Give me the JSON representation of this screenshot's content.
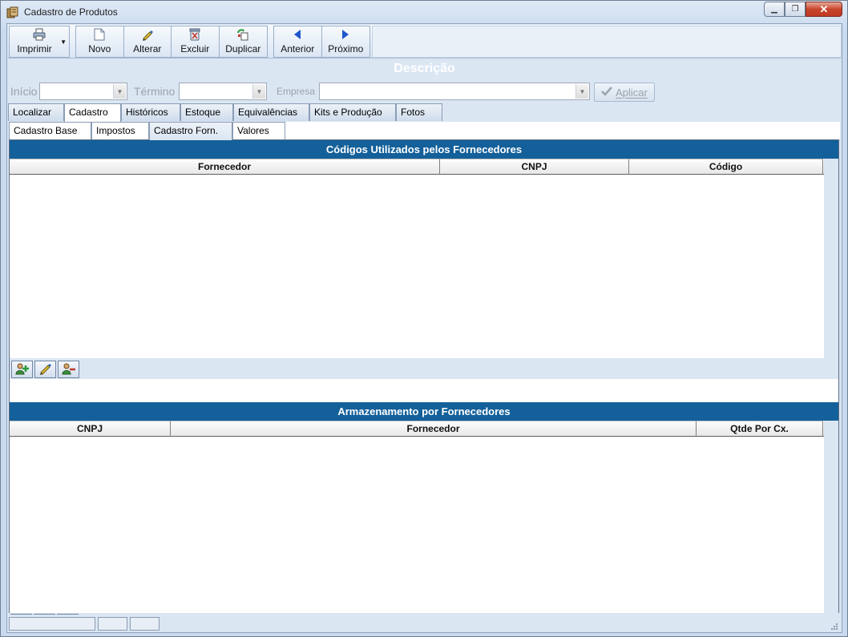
{
  "window": {
    "title": "Cadastro de Produtos"
  },
  "toolbar": {
    "imprimir": "Imprimir",
    "novo": "Novo",
    "alterar": "Alterar",
    "excluir": "Excluir",
    "duplicar": "Duplicar",
    "anterior": "Anterior",
    "proximo": "Próximo"
  },
  "header": {
    "descricao": "Descrição"
  },
  "filters": {
    "inicio_label": "Início",
    "termino_label": "Término",
    "empresa_label": "Empresa",
    "aplicar_label": "Aplicar"
  },
  "main_tabs": [
    "Localizar",
    "Cadastro",
    "Históricos",
    "Estoque",
    "Equivalências",
    "Kits e Produção",
    "Fotos"
  ],
  "sub_tabs": [
    "Cadastro Base",
    "Impostos",
    "Cadastro Forn.",
    "Valores"
  ],
  "section1": {
    "title": "Códigos Utilizados pelos Fornecedores",
    "columns": [
      "Fornecedor",
      "CNPJ",
      "Código"
    ]
  },
  "section2": {
    "title": "Armazenamento por Fornecedores",
    "columns": [
      "CNPJ",
      "Fornecedor",
      "Qtde Por Cx."
    ]
  },
  "colors": {
    "section_header": "#14609a",
    "window_bg": "#dbe6f3"
  },
  "icons": [
    "printer-icon",
    "new-document-icon",
    "edit-pen-icon",
    "delete-icon",
    "duplicate-icon",
    "arrow-left-icon",
    "arrow-right-icon",
    "checkmark-icon",
    "add-user-icon",
    "edit-user-icon",
    "remove-user-icon"
  ]
}
